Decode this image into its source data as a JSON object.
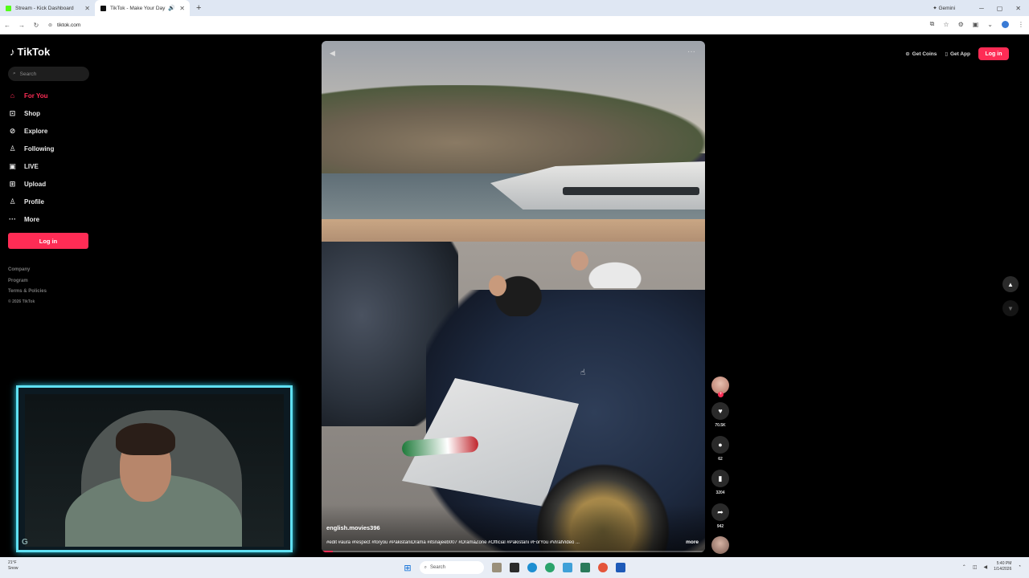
{
  "browser": {
    "tabs": [
      {
        "title": "Stream - Kick Dashboard",
        "favicon_color": "#53fc18"
      },
      {
        "title": "TikTok - Make Your Day",
        "favicon_color": "#111111"
      }
    ],
    "gemini_label": "Gemini",
    "url": "tiktok.com"
  },
  "tiktok": {
    "logo": "TikTok",
    "search_placeholder": "Search",
    "nav": [
      {
        "label": "For You",
        "icon": "home-icon",
        "active": true
      },
      {
        "label": "Shop",
        "icon": "shopping-bag-icon"
      },
      {
        "label": "Explore",
        "icon": "compass-icon"
      },
      {
        "label": "Following",
        "icon": "user-follow-icon"
      },
      {
        "label": "LIVE",
        "icon": "live-icon"
      },
      {
        "label": "Upload",
        "icon": "upload-icon"
      },
      {
        "label": "Profile",
        "icon": "profile-icon"
      },
      {
        "label": "More",
        "icon": "more-dots-icon"
      }
    ],
    "login_label": "Log in",
    "footer": {
      "company": "Company",
      "program": "Program",
      "terms": "Terms & Policies",
      "copyright": "© 2026 TikTok"
    },
    "top_buttons": {
      "get_coins": "Get Coins",
      "get_app": "Get App",
      "login": "Log in"
    },
    "video": {
      "author": "english.movies396",
      "caption": "#edit #aura #respect #foryou #PakistaniDrama #itsnajeeb007 #DramaZone #Official #Pakistani #ForYou #ViralVideo ...",
      "more_label": "more",
      "progress_fraction": 0.03
    },
    "actions": {
      "likes": "70.5K",
      "comments": "62",
      "saves": "3204",
      "shares": "942"
    }
  },
  "taskbar": {
    "weather_temp": "21°F",
    "weather_desc": "Snow",
    "search_placeholder": "Search",
    "time": "5:40 PM",
    "date": "1/14/2026"
  },
  "colors": {
    "accent": "#fe2c55",
    "webcam_frame": "#5fe0f2"
  }
}
